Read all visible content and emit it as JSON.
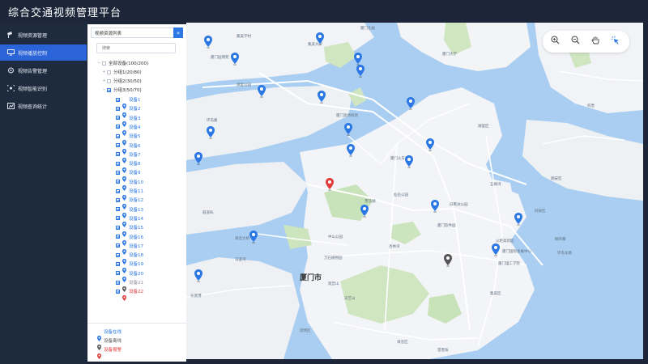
{
  "app": {
    "title": "综合交通视频管理平台"
  },
  "sidebar": {
    "items": [
      {
        "label": "视频资源管理",
        "icon": "camera-icon",
        "active": false
      },
      {
        "label": "视频播放控制",
        "icon": "monitor-icon",
        "active": true
      },
      {
        "label": "视频告警管理",
        "icon": "alarm-icon",
        "active": false
      },
      {
        "label": "视频智能识别",
        "icon": "scan-icon",
        "active": false
      },
      {
        "label": "视频查询统计",
        "icon": "chart-icon",
        "active": false
      }
    ]
  },
  "panel": {
    "title": "视频资源列表",
    "collapse_glyph": "«",
    "search_placeholder": "搜索",
    "tree": {
      "root": "全部设备(100/200)",
      "groups": [
        "分组1(20/80)",
        "分组2(30/50)",
        "分组3(50/70)"
      ],
      "devices": [
        {
          "label": "设备1",
          "status": "online"
        },
        {
          "label": "设备2",
          "status": "online"
        },
        {
          "label": "设备3",
          "status": "online"
        },
        {
          "label": "设备4",
          "status": "online"
        },
        {
          "label": "设备5",
          "status": "online"
        },
        {
          "label": "设备6",
          "status": "online"
        },
        {
          "label": "设备7",
          "status": "online"
        },
        {
          "label": "设备8",
          "status": "online"
        },
        {
          "label": "设备9",
          "status": "online"
        },
        {
          "label": "设备10",
          "status": "online"
        },
        {
          "label": "设备11",
          "status": "online"
        },
        {
          "label": "设备12",
          "status": "online"
        },
        {
          "label": "设备13",
          "status": "online"
        },
        {
          "label": "设备14",
          "status": "online"
        },
        {
          "label": "设备15",
          "status": "online"
        },
        {
          "label": "设备16",
          "status": "online"
        },
        {
          "label": "设备17",
          "status": "online"
        },
        {
          "label": "设备18",
          "status": "online"
        },
        {
          "label": "设备19",
          "status": "online"
        },
        {
          "label": "设备20",
          "status": "online"
        },
        {
          "label": "设备21",
          "status": "offline"
        },
        {
          "label": "设备22",
          "status": "alarm"
        }
      ]
    },
    "legend": [
      {
        "label": "设备在线",
        "status": "online"
      },
      {
        "label": "设备离线",
        "status": "offline"
      },
      {
        "label": "设备报警",
        "status": "alarm"
      }
    ]
  },
  "colors": {
    "online": "#2b78e4",
    "offline": "#555555",
    "alarm": "#e23b3b",
    "accent": "#2b63d9"
  },
  "map": {
    "city_label": "厦门市",
    "labels": [
      "集美学村",
      "集美大学",
      "厦门北站",
      "厦门高崎机场",
      "厦门大学",
      "厦门园博苑",
      "厦门火车站",
      "筼筜湖",
      "湖里公园",
      "鼓浪屿",
      "五缘湾",
      "厦门国际会展中心",
      "环岛路",
      "中山公园",
      "白鹭洲公园",
      "仙岳公园",
      "万石植物园",
      "曾厝垵",
      "海沧大桥",
      "东渡港",
      "厦门软件园",
      "观音山",
      "天竺山",
      "马銮湾",
      "杏林湾",
      "思明区",
      "湖里区",
      "海沧区",
      "集美区",
      "同安区",
      "翔安区",
      "火炬高新区",
      "厦门理工学院",
      "椰风寨",
      "环岛东路",
      "何厝"
    ],
    "toolbar": {
      "zoom_in": "zoom-in-icon",
      "zoom_out": "zoom-out-icon",
      "pan": "hand-icon",
      "select": "pointer-icon"
    }
  }
}
